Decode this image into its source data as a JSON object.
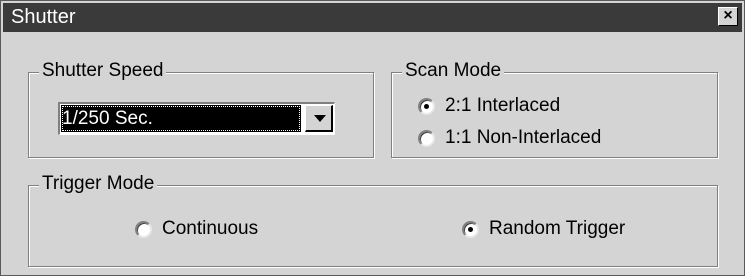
{
  "window": {
    "title": "Shutter",
    "close_glyph": "×"
  },
  "shutter_speed": {
    "legend": "Shutter Speed",
    "selected": "1/250 Sec."
  },
  "scan_mode": {
    "legend": "Scan Mode",
    "options": [
      {
        "label": "2:1 Interlaced",
        "checked": true
      },
      {
        "label": "1:1 Non-Interlaced",
        "checked": false
      }
    ]
  },
  "trigger_mode": {
    "legend": "Trigger Mode",
    "options": [
      {
        "label": "Continuous",
        "checked": false
      },
      {
        "label": "Random Trigger",
        "checked": true
      }
    ]
  },
  "icons": {
    "close": "close-icon",
    "dropdown": "chevron-down-icon",
    "radio": "radio-icon"
  }
}
